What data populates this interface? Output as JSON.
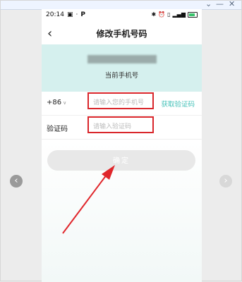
{
  "status_bar": {
    "time": "20:14",
    "p_badge": "P"
  },
  "header": {
    "back_icon": "chevron-left-icon",
    "title": "修改手机号码"
  },
  "current_phone": {
    "label": "当前手机号"
  },
  "form": {
    "country_code": "+86",
    "phone_placeholder": "请输入您的手机号",
    "get_code_label": "获取验证码",
    "code_label": "验证码",
    "code_placeholder": "请输入验证码"
  },
  "confirm_button": "确定",
  "colors": {
    "accent": "#45c1b8",
    "current_phone_bg": "#d5f0ee",
    "highlight": "#d9262b"
  }
}
